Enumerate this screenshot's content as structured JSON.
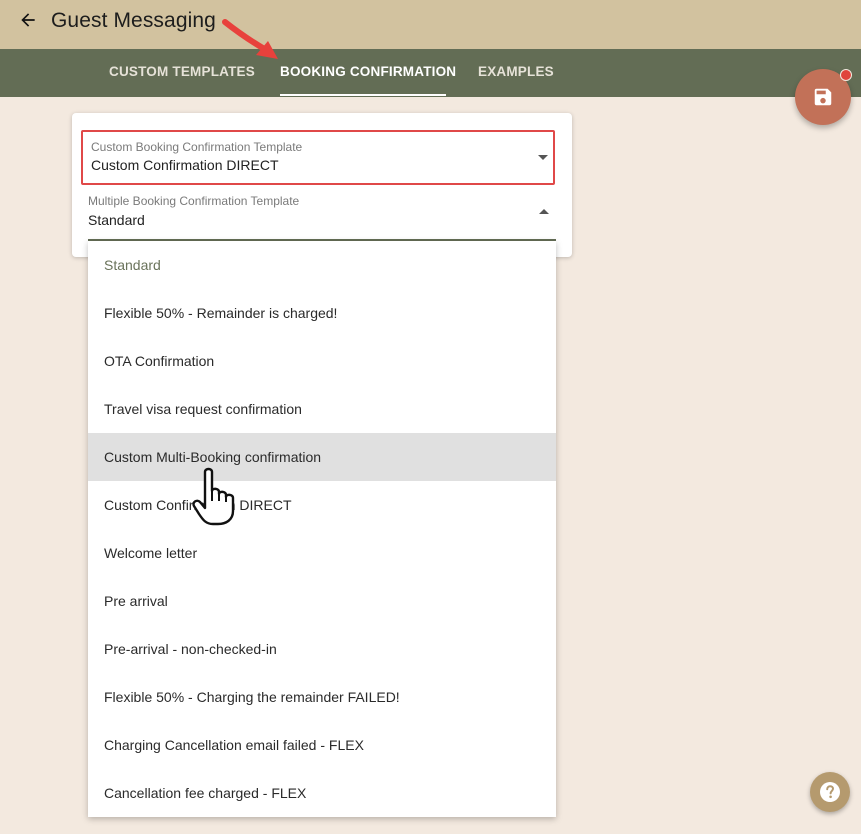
{
  "header": {
    "title": "Guest Messaging",
    "back_icon": "arrow-left-icon"
  },
  "tabs": [
    {
      "label": "CUSTOM TEMPLATES",
      "active": false
    },
    {
      "label": "BOOKING CONFIRMATION",
      "active": true
    },
    {
      "label": "EXAMPLES",
      "active": false
    }
  ],
  "colors": {
    "header_bg": "#d2c29f",
    "tabbar_bg": "#636d55",
    "page_bg": "#f3e9df",
    "fab_bg": "#c27158",
    "highlight_border": "#e04848",
    "help_bg": "#b59a6e"
  },
  "fields": {
    "custom_booking": {
      "label": "Custom Booking Confirmation Template",
      "value": "Custom Confirmation DIRECT"
    },
    "multiple_booking": {
      "label": "Multiple Booking Confirmation Template",
      "value": "Standard"
    }
  },
  "dropdown": {
    "selected": "Standard",
    "hovered": "Custom Multi-Booking confirmation",
    "options": [
      "Standard",
      "Flexible 50% - Remainder is charged!",
      "OTA Confirmation",
      "Travel visa request confirmation",
      "Custom Multi-Booking confirmation",
      "Custom Confirmation DIRECT",
      "Welcome letter",
      "Pre arrival",
      "Pre-arrival - non-checked-in",
      "Flexible 50% - Charging the remainder FAILED!",
      "Charging Cancellation email failed - FLEX",
      "Cancellation fee charged - FLEX"
    ]
  },
  "fab": {
    "icon": "save-icon",
    "has_notification": true
  },
  "help": {
    "icon": "help-icon"
  }
}
